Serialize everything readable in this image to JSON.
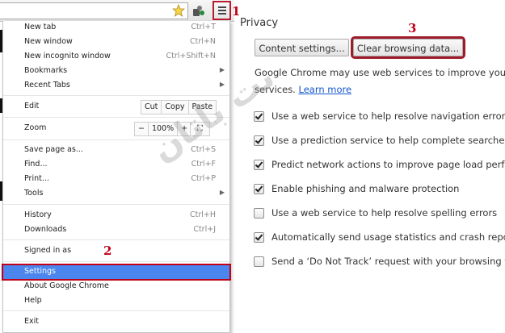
{
  "menu": {
    "new_tab": {
      "label": "New tab",
      "shortcut": "Ctrl+T"
    },
    "new_window": {
      "label": "New window",
      "shortcut": "Ctrl+N"
    },
    "new_incognito": {
      "label": "New incognito window",
      "shortcut": "Ctrl+Shift+N"
    },
    "bookmarks": {
      "label": "Bookmarks"
    },
    "recent_tabs": {
      "label": "Recent Tabs"
    },
    "edit": {
      "label": "Edit",
      "cut": "Cut",
      "copy": "Copy",
      "paste": "Paste"
    },
    "zoom": {
      "label": "Zoom",
      "minus": "−",
      "level": "100%",
      "plus": "+",
      "fullscreen": "⛶"
    },
    "save_page": {
      "label": "Save page as...",
      "shortcut": "Ctrl+S"
    },
    "find": {
      "label": "Find...",
      "shortcut": "Ctrl+F"
    },
    "print": {
      "label": "Print...",
      "shortcut": "Ctrl+P"
    },
    "tools": {
      "label": "Tools"
    },
    "history": {
      "label": "History",
      "shortcut": "Ctrl+H"
    },
    "downloads": {
      "label": "Downloads",
      "shortcut": "Ctrl+J"
    },
    "signed_in": {
      "label": "Signed in as"
    },
    "settings": {
      "label": "Settings"
    },
    "about": {
      "label": "About Google Chrome"
    },
    "help": {
      "label": "Help"
    },
    "exit": {
      "label": "Exit"
    }
  },
  "annotations": {
    "step1": "1",
    "step2": "2",
    "step3": "3"
  },
  "privacy": {
    "heading": "Privacy",
    "content_settings": "Content settings...",
    "clear_browsing": "Clear browsing data...",
    "desc_line1": "Google Chrome may use web services to improve your bro",
    "desc_line2": "services. ",
    "learn_more": "Learn more",
    "options": [
      {
        "label": "Use a web service to help resolve navigation errors",
        "checked": true
      },
      {
        "label": "Use a prediction service to help complete searches and",
        "checked": true
      },
      {
        "label": "Predict network actions to improve page load performa",
        "checked": true
      },
      {
        "label": "Enable phishing and malware protection",
        "checked": true
      },
      {
        "label": "Use a web service to help resolve spelling errors",
        "checked": false
      },
      {
        "label": "Automatically send usage statistics and crash reports to",
        "checked": true
      },
      {
        "label": "Send a ‘Do Not Track’ request with your browsing traffi",
        "checked": false
      }
    ]
  },
  "watermark": "نت باتان",
  "colors": {
    "accent_red": "#c00018",
    "selection_blue": "#4a86ee",
    "link": "#1155cc"
  }
}
